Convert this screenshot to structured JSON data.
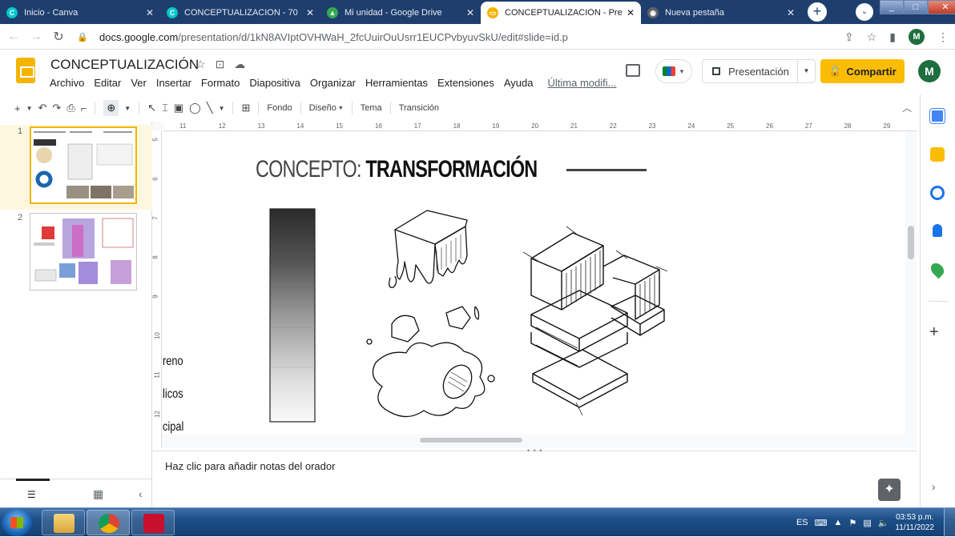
{
  "browser": {
    "tabs": [
      {
        "title": "Inicio - Canva",
        "color": "#00c4cc",
        "glyph": "C",
        "active": false
      },
      {
        "title": "CONCEPTUALIZACION - 70 ×",
        "color": "#00c4cc",
        "glyph": "C",
        "active": false
      },
      {
        "title": "Mi unidad - Google Drive",
        "color": "#34a853",
        "glyph": "▲",
        "active": false
      },
      {
        "title": "CONCEPTUALIZACIÓN - Prese",
        "color": "#f4b400",
        "glyph": "▭",
        "active": true
      },
      {
        "title": "Nueva pestaña",
        "color": "#5f6368",
        "glyph": "◉",
        "active": false
      }
    ],
    "close_glyph": "✕",
    "newtab_glyph": "+",
    "url_host": "docs.google.com",
    "url_path": "/presentation/d/1kN8AVIptOVHWaH_2fcUuirOuUsrr1EUCPvbyuvSkU/edit#slide=id.p",
    "profile_initial": "M"
  },
  "doc": {
    "title": "CONCEPTUALIZACIÓN",
    "menus": [
      "Archivo",
      "Editar",
      "Ver",
      "Insertar",
      "Formato",
      "Diapositiva",
      "Organizar",
      "Herramientas",
      "Extensiones",
      "Ayuda"
    ],
    "last_edit": "Última modifi...",
    "present_label": "Presentación",
    "share_label": "Compartir",
    "avatar_initial": "M"
  },
  "toolbar": {
    "background_label": "Fondo",
    "layout_label": "Diseño",
    "theme_label": "Tema",
    "transition_label": "Transición"
  },
  "filmstrip": {
    "slide_numbers": [
      "1",
      "2"
    ]
  },
  "ruler": {
    "h_ticks": [
      "11",
      "12",
      "13",
      "14",
      "15",
      "16",
      "17",
      "18",
      "19",
      "20",
      "21",
      "22",
      "23",
      "24",
      "25",
      "26",
      "27",
      "28",
      "29"
    ],
    "v_ticks": [
      "5",
      "6",
      "7",
      "8",
      "9",
      "10",
      "11",
      "12"
    ]
  },
  "slide": {
    "title_light": "CONCEPTO:",
    "title_bold": "TRANSFORMACIÓN",
    "side_labels": [
      "reno",
      "licos",
      "cipal"
    ]
  },
  "notes": {
    "placeholder": "Haz clic para añadir notas del orador"
  },
  "taskbar": {
    "language": "ES",
    "time": "03:53 p.m.",
    "date": "11/11/2022"
  }
}
